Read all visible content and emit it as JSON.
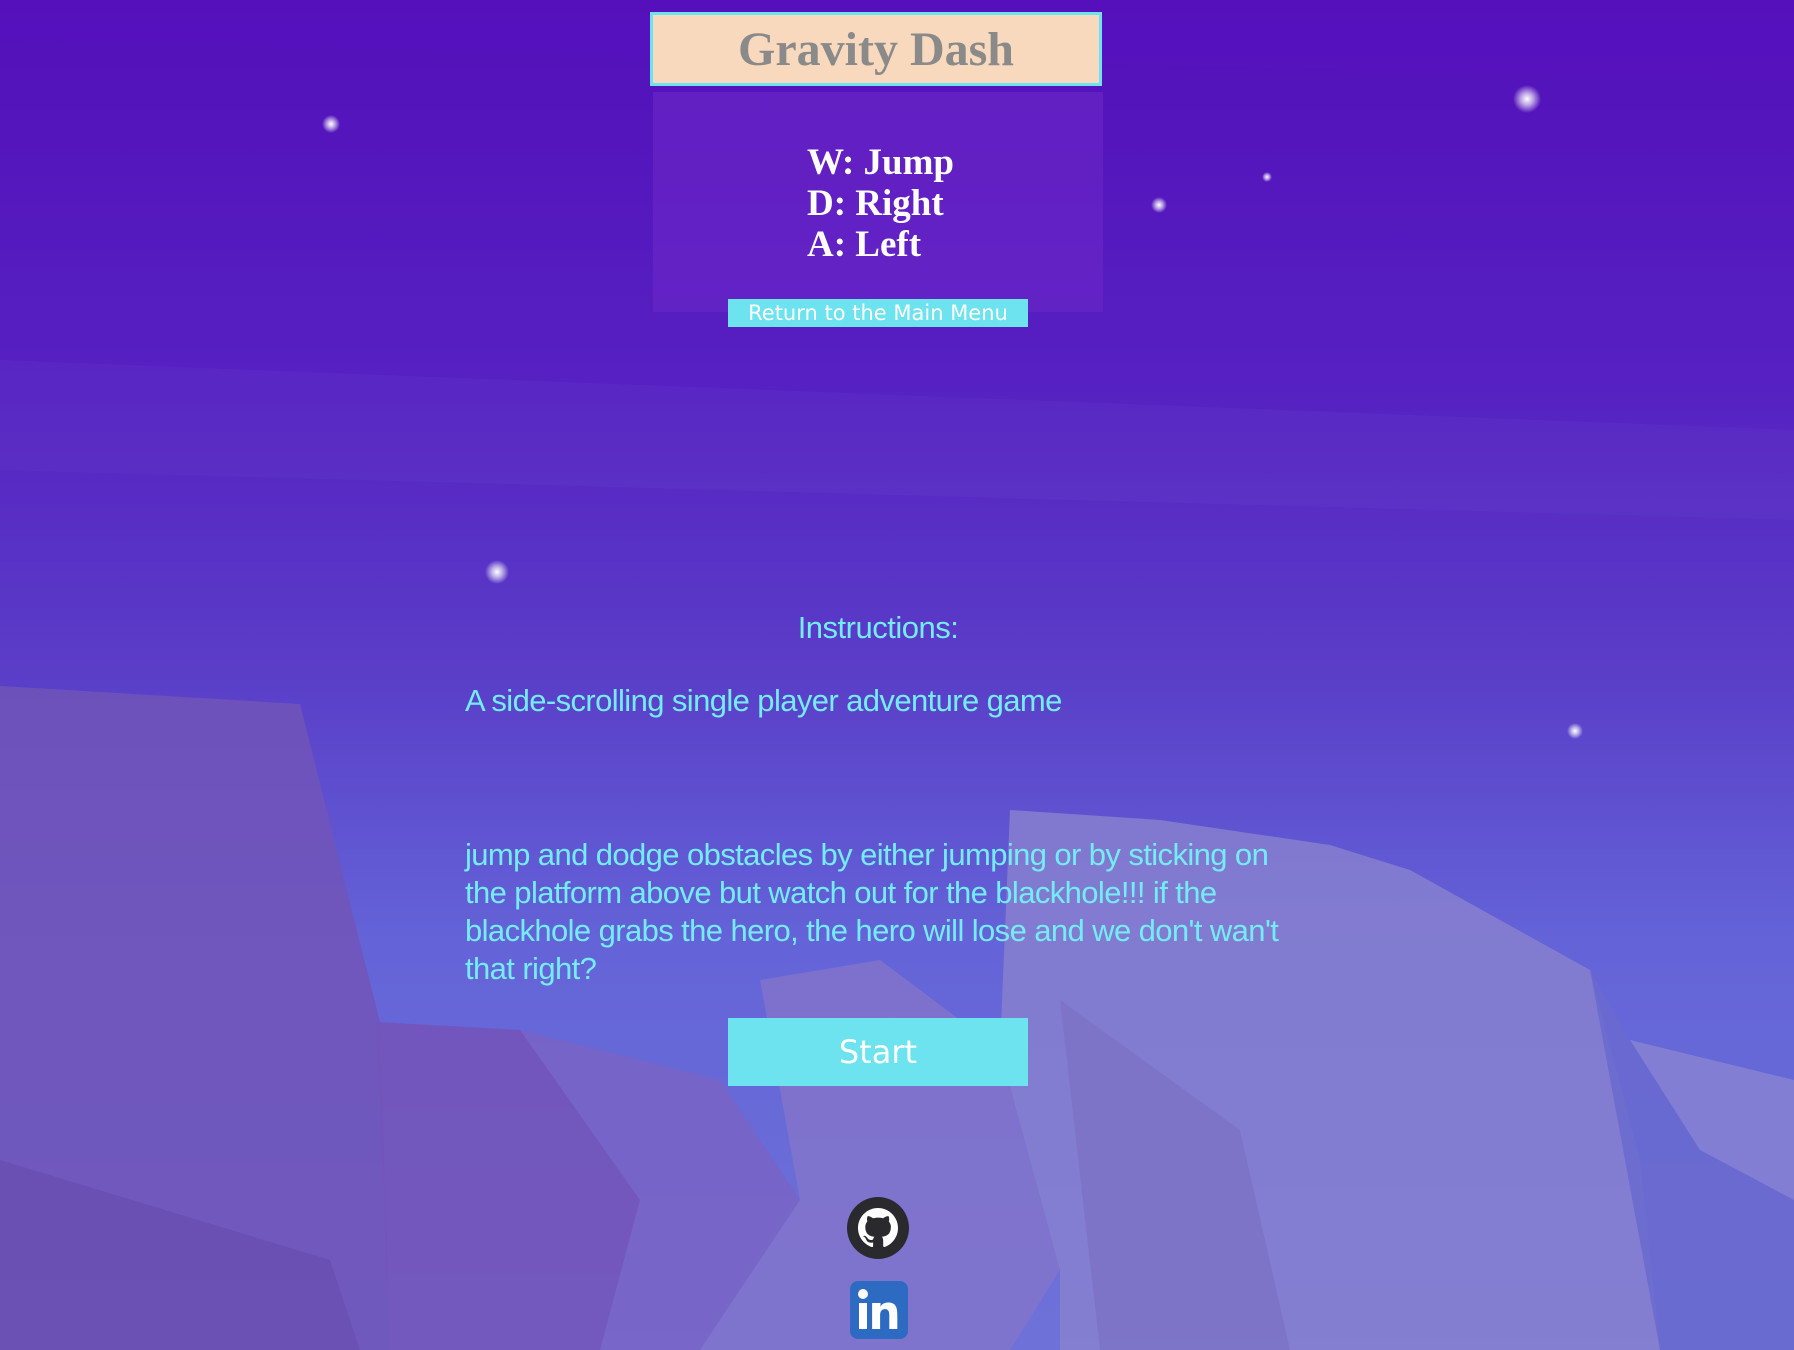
{
  "game": {
    "title": "Gravity Dash",
    "controls": [
      "W: Jump",
      "D: Right",
      "A: Left"
    ],
    "return_label": "Return to the Main Menu"
  },
  "instructions": {
    "heading": "Instructions:",
    "paragraph_1": "A side-scrolling single player adventure game",
    "paragraph_2": "jump and dodge obstacles by either jumping or by sticking on the platform above but watch out for the blackhole!!! if the blackhole grabs the hero, the hero will lose and we don't wan't that right?"
  },
  "start_label": "Start",
  "footer": {
    "icons": [
      "github-icon",
      "linkedin-icon"
    ]
  },
  "colors": {
    "accent": "#6de3ef",
    "title_bg": "#f8d9bd",
    "title_text": "#8a8a8a",
    "instruction_text": "#74ecf6",
    "background_top": "#5310b9",
    "background_bottom": "#6e72d8"
  }
}
